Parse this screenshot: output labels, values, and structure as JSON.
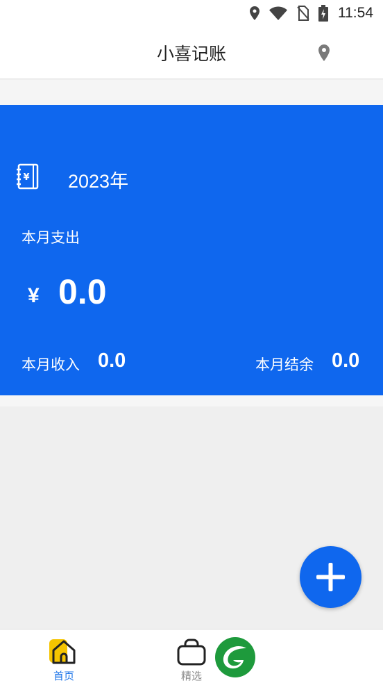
{
  "status_bar": {
    "time": "11:54",
    "icons": [
      "location-icon",
      "wifi-icon",
      "no-sim-icon",
      "battery-charging-icon"
    ]
  },
  "app_bar": {
    "title": "小喜记账",
    "right_icon": "location-pin-icon"
  },
  "summary": {
    "year": "2023年",
    "expense_label": "本月支出",
    "currency": "¥",
    "expense_value": "0.0",
    "income_label": "本月收入",
    "income_value": "0.0",
    "balance_label": "本月结余",
    "balance_value": "0.0"
  },
  "fab": {
    "icon": "plus-icon"
  },
  "bottom_nav": {
    "items": [
      {
        "label": "首页",
        "icon": "home-icon",
        "active": true
      },
      {
        "label": "精选",
        "icon": "bag-icon",
        "active": false
      }
    ],
    "promo_icon": "leaf-logo-icon"
  },
  "colors": {
    "primary": "#0f67ee",
    "active_tab": "#1a73e8",
    "home_icon_accent": "#f5c400",
    "promo_green": "#1e9a3c"
  }
}
